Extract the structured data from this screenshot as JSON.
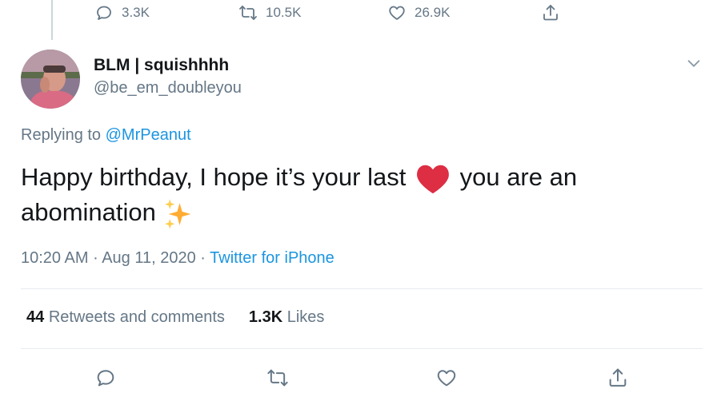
{
  "previous_tweet": {
    "reply_count": "3.3K",
    "retweet_count": "10.5K",
    "like_count": "26.9K"
  },
  "author": {
    "display_name": "BLM | squishhhh",
    "handle": "@be_em_doubleyou"
  },
  "replying": {
    "prefix": "Replying to",
    "mention": "@MrPeanut"
  },
  "tweet": {
    "text_part1": "Happy birthday, I hope it’s your last",
    "text_part2": "you are an abomination",
    "emoji_1": "red-heart",
    "emoji_2": "sparkles"
  },
  "meta": {
    "time": "10:20 AM",
    "sep1": "·",
    "date": "Aug 11, 2020",
    "sep2": "·",
    "source": "Twitter for iPhone"
  },
  "stats": {
    "retweets_count": "44",
    "retweets_label": "Retweets and comments",
    "likes_count": "1.3K",
    "likes_label": "Likes"
  },
  "colors": {
    "text_primary": "#14171a",
    "text_secondary": "#657786",
    "link": "#1b95e0",
    "divider": "#e6ecf0",
    "heart": "#dd2e44",
    "sparkle": "#ffac33"
  }
}
